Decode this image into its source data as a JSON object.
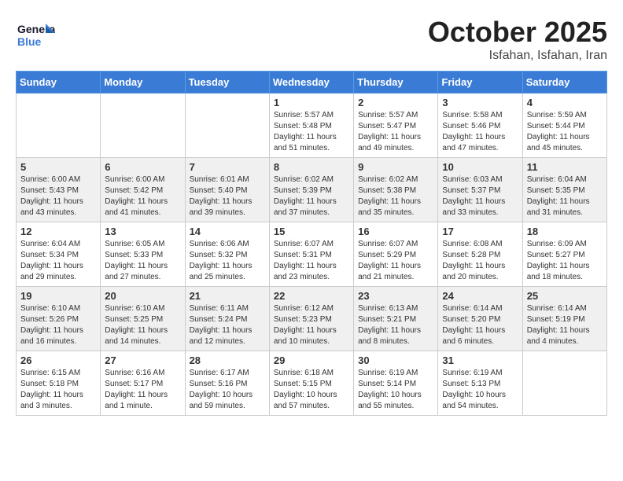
{
  "logo": {
    "line1": "General",
    "line2": "Blue"
  },
  "title": "October 2025",
  "location": "Isfahan, Isfahan, Iran",
  "weekdays": [
    "Sunday",
    "Monday",
    "Tuesday",
    "Wednesday",
    "Thursday",
    "Friday",
    "Saturday"
  ],
  "weeks": [
    [
      {
        "day": "",
        "sunrise": "",
        "sunset": "",
        "daylight": ""
      },
      {
        "day": "",
        "sunrise": "",
        "sunset": "",
        "daylight": ""
      },
      {
        "day": "",
        "sunrise": "",
        "sunset": "",
        "daylight": ""
      },
      {
        "day": "1",
        "sunrise": "Sunrise: 5:57 AM",
        "sunset": "Sunset: 5:48 PM",
        "daylight": "Daylight: 11 hours and 51 minutes."
      },
      {
        "day": "2",
        "sunrise": "Sunrise: 5:57 AM",
        "sunset": "Sunset: 5:47 PM",
        "daylight": "Daylight: 11 hours and 49 minutes."
      },
      {
        "day": "3",
        "sunrise": "Sunrise: 5:58 AM",
        "sunset": "Sunset: 5:46 PM",
        "daylight": "Daylight: 11 hours and 47 minutes."
      },
      {
        "day": "4",
        "sunrise": "Sunrise: 5:59 AM",
        "sunset": "Sunset: 5:44 PM",
        "daylight": "Daylight: 11 hours and 45 minutes."
      }
    ],
    [
      {
        "day": "5",
        "sunrise": "Sunrise: 6:00 AM",
        "sunset": "Sunset: 5:43 PM",
        "daylight": "Daylight: 11 hours and 43 minutes."
      },
      {
        "day": "6",
        "sunrise": "Sunrise: 6:00 AM",
        "sunset": "Sunset: 5:42 PM",
        "daylight": "Daylight: 11 hours and 41 minutes."
      },
      {
        "day": "7",
        "sunrise": "Sunrise: 6:01 AM",
        "sunset": "Sunset: 5:40 PM",
        "daylight": "Daylight: 11 hours and 39 minutes."
      },
      {
        "day": "8",
        "sunrise": "Sunrise: 6:02 AM",
        "sunset": "Sunset: 5:39 PM",
        "daylight": "Daylight: 11 hours and 37 minutes."
      },
      {
        "day": "9",
        "sunrise": "Sunrise: 6:02 AM",
        "sunset": "Sunset: 5:38 PM",
        "daylight": "Daylight: 11 hours and 35 minutes."
      },
      {
        "day": "10",
        "sunrise": "Sunrise: 6:03 AM",
        "sunset": "Sunset: 5:37 PM",
        "daylight": "Daylight: 11 hours and 33 minutes."
      },
      {
        "day": "11",
        "sunrise": "Sunrise: 6:04 AM",
        "sunset": "Sunset: 5:35 PM",
        "daylight": "Daylight: 11 hours and 31 minutes."
      }
    ],
    [
      {
        "day": "12",
        "sunrise": "Sunrise: 6:04 AM",
        "sunset": "Sunset: 5:34 PM",
        "daylight": "Daylight: 11 hours and 29 minutes."
      },
      {
        "day": "13",
        "sunrise": "Sunrise: 6:05 AM",
        "sunset": "Sunset: 5:33 PM",
        "daylight": "Daylight: 11 hours and 27 minutes."
      },
      {
        "day": "14",
        "sunrise": "Sunrise: 6:06 AM",
        "sunset": "Sunset: 5:32 PM",
        "daylight": "Daylight: 11 hours and 25 minutes."
      },
      {
        "day": "15",
        "sunrise": "Sunrise: 6:07 AM",
        "sunset": "Sunset: 5:31 PM",
        "daylight": "Daylight: 11 hours and 23 minutes."
      },
      {
        "day": "16",
        "sunrise": "Sunrise: 6:07 AM",
        "sunset": "Sunset: 5:29 PM",
        "daylight": "Daylight: 11 hours and 21 minutes."
      },
      {
        "day": "17",
        "sunrise": "Sunrise: 6:08 AM",
        "sunset": "Sunset: 5:28 PM",
        "daylight": "Daylight: 11 hours and 20 minutes."
      },
      {
        "day": "18",
        "sunrise": "Sunrise: 6:09 AM",
        "sunset": "Sunset: 5:27 PM",
        "daylight": "Daylight: 11 hours and 18 minutes."
      }
    ],
    [
      {
        "day": "19",
        "sunrise": "Sunrise: 6:10 AM",
        "sunset": "Sunset: 5:26 PM",
        "daylight": "Daylight: 11 hours and 16 minutes."
      },
      {
        "day": "20",
        "sunrise": "Sunrise: 6:10 AM",
        "sunset": "Sunset: 5:25 PM",
        "daylight": "Daylight: 11 hours and 14 minutes."
      },
      {
        "day": "21",
        "sunrise": "Sunrise: 6:11 AM",
        "sunset": "Sunset: 5:24 PM",
        "daylight": "Daylight: 11 hours and 12 minutes."
      },
      {
        "day": "22",
        "sunrise": "Sunrise: 6:12 AM",
        "sunset": "Sunset: 5:23 PM",
        "daylight": "Daylight: 11 hours and 10 minutes."
      },
      {
        "day": "23",
        "sunrise": "Sunrise: 6:13 AM",
        "sunset": "Sunset: 5:21 PM",
        "daylight": "Daylight: 11 hours and 8 minutes."
      },
      {
        "day": "24",
        "sunrise": "Sunrise: 6:14 AM",
        "sunset": "Sunset: 5:20 PM",
        "daylight": "Daylight: 11 hours and 6 minutes."
      },
      {
        "day": "25",
        "sunrise": "Sunrise: 6:14 AM",
        "sunset": "Sunset: 5:19 PM",
        "daylight": "Daylight: 11 hours and 4 minutes."
      }
    ],
    [
      {
        "day": "26",
        "sunrise": "Sunrise: 6:15 AM",
        "sunset": "Sunset: 5:18 PM",
        "daylight": "Daylight: 11 hours and 3 minutes."
      },
      {
        "day": "27",
        "sunrise": "Sunrise: 6:16 AM",
        "sunset": "Sunset: 5:17 PM",
        "daylight": "Daylight: 11 hours and 1 minute."
      },
      {
        "day": "28",
        "sunrise": "Sunrise: 6:17 AM",
        "sunset": "Sunset: 5:16 PM",
        "daylight": "Daylight: 10 hours and 59 minutes."
      },
      {
        "day": "29",
        "sunrise": "Sunrise: 6:18 AM",
        "sunset": "Sunset: 5:15 PM",
        "daylight": "Daylight: 10 hours and 57 minutes."
      },
      {
        "day": "30",
        "sunrise": "Sunrise: 6:19 AM",
        "sunset": "Sunset: 5:14 PM",
        "daylight": "Daylight: 10 hours and 55 minutes."
      },
      {
        "day": "31",
        "sunrise": "Sunrise: 6:19 AM",
        "sunset": "Sunset: 5:13 PM",
        "daylight": "Daylight: 10 hours and 54 minutes."
      },
      {
        "day": "",
        "sunrise": "",
        "sunset": "",
        "daylight": ""
      }
    ]
  ]
}
